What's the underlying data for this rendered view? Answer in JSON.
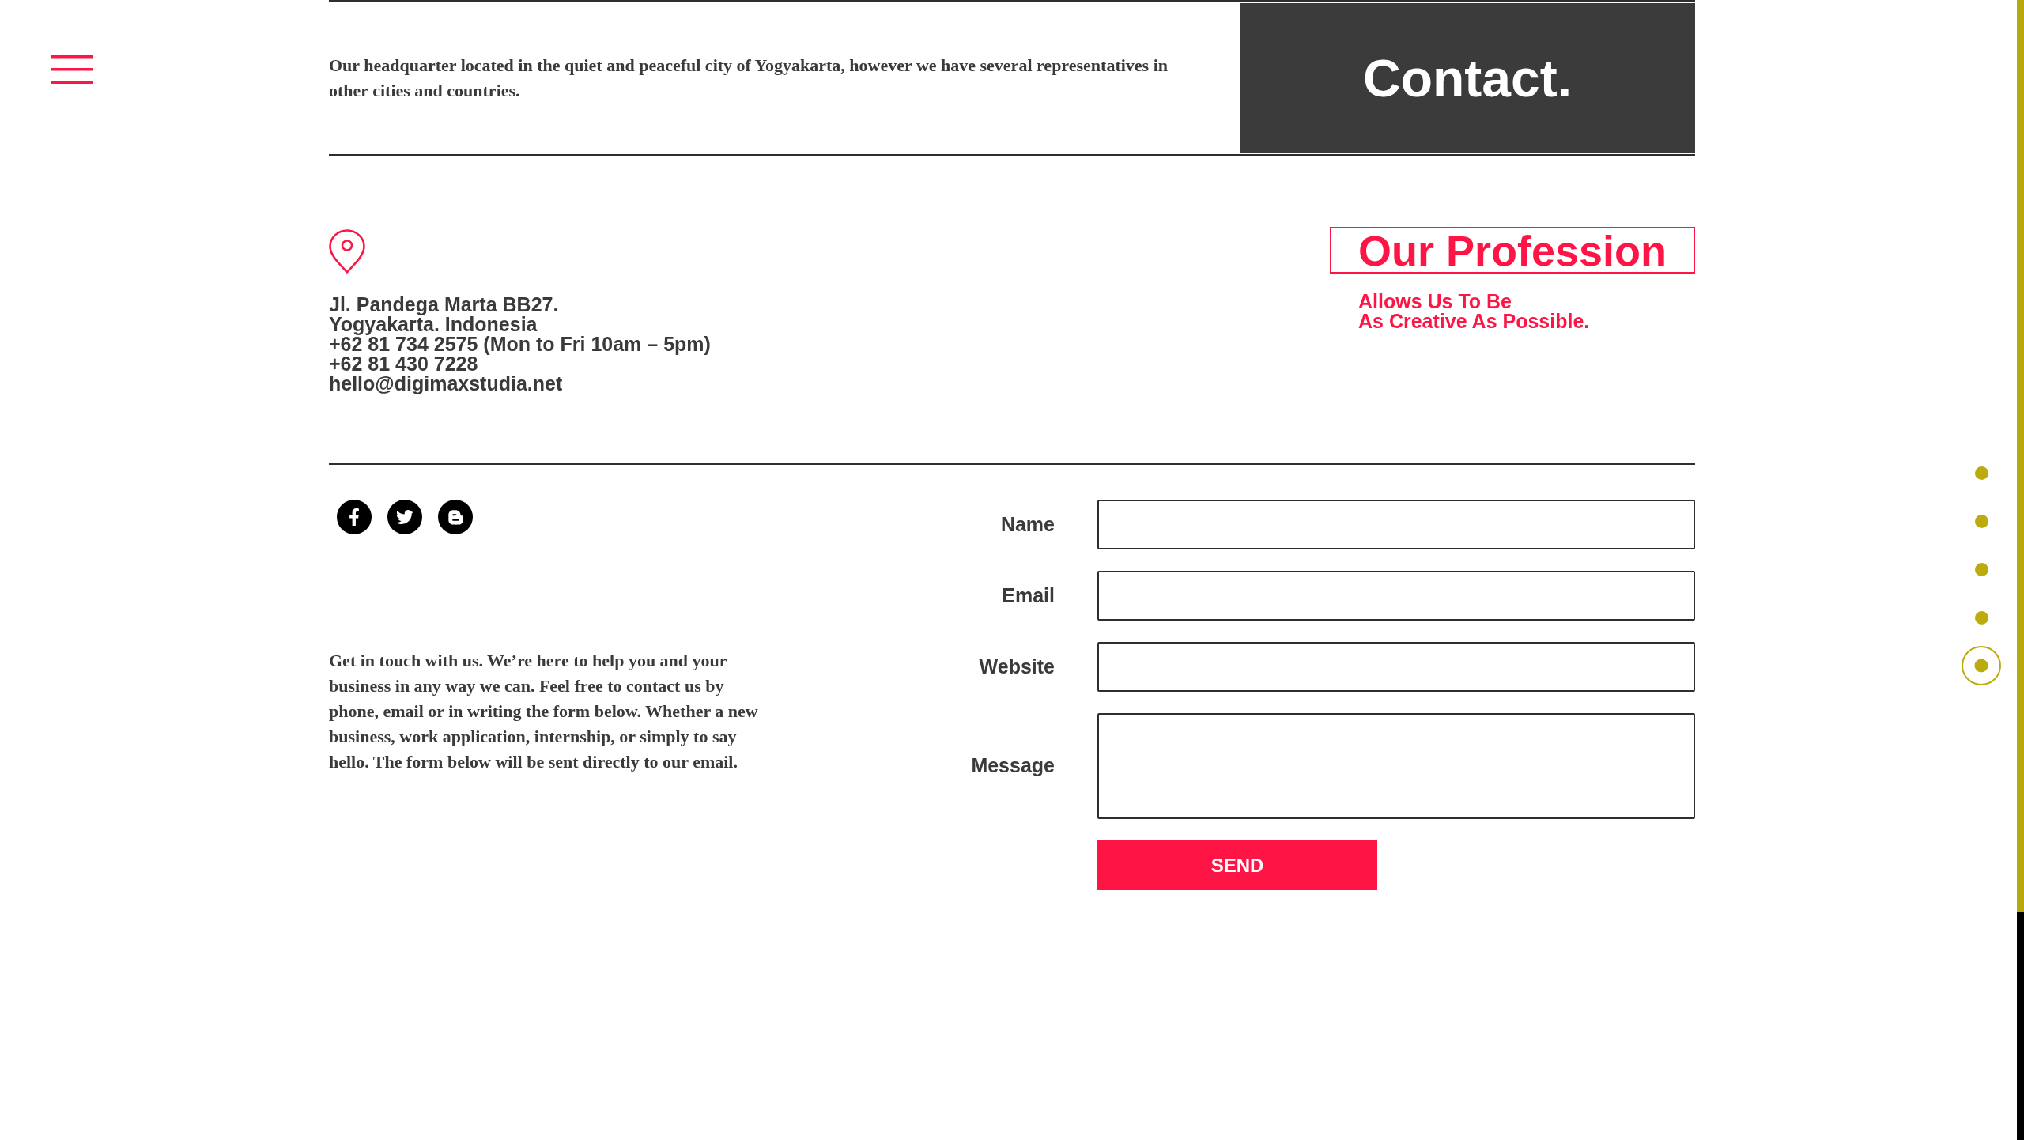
{
  "header": {
    "intro": "Our headquarter located in the quiet and peaceful city of Yogyakarta, however we have several representatives in other cities and countries.",
    "title": "Contact."
  },
  "address": {
    "lines": [
      "Jl. Pandega Marta BB27.",
      "Yogyakarta. Indonesia",
      "+62 81 734 2575 (Mon to Fri 10am – 5pm)",
      "+62 81 430 7228",
      "hello@digimaxstudia.net"
    ]
  },
  "profession": {
    "heading": "Our Profession",
    "tagline": [
      "Allows Us To Be",
      "As Creative As Possible."
    ]
  },
  "contact_note": "Get in touch with us. We’re here to help you and your business in any way we can. Feel free to contact us by phone, email or in writing the form below. Whether a new business, work application, internship, or simply to say hello. The form below will be sent directly to our email.",
  "form": {
    "fields": [
      {
        "label": "Name",
        "kind": "input"
      },
      {
        "label": "Email",
        "kind": "input"
      },
      {
        "label": "Website",
        "kind": "input"
      },
      {
        "label": "Message",
        "kind": "textarea"
      }
    ],
    "submit": "SEND"
  },
  "section_nav": [
    {
      "selected": false
    },
    {
      "selected": false
    },
    {
      "selected": false
    },
    {
      "selected": false
    },
    {
      "selected": true
    }
  ],
  "scroll_progress": {
    "level": 0.8
  }
}
